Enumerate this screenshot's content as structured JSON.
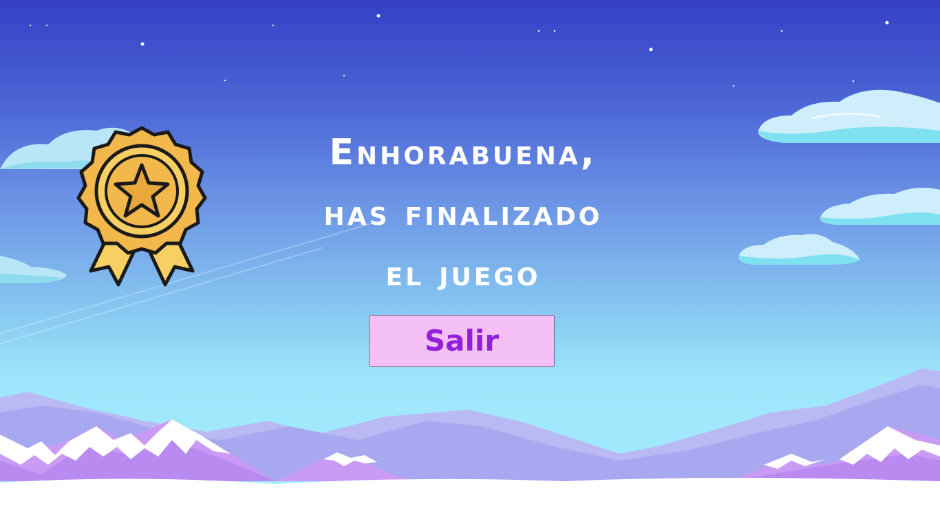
{
  "screen": {
    "title_lines": [
      "Enhorabuena,",
      "has finalizado",
      "el juego"
    ],
    "exit_button_label": "Salir"
  },
  "icons": {
    "award": "medal-star-icon"
  },
  "colors": {
    "sky_top": "#3440c5",
    "sky_bottom": "#a5ecfd",
    "button_bg": "#f3bff5",
    "button_text": "#8f1fd8",
    "title_text": "#ffffff",
    "medal_gold": "#f2b84b"
  }
}
